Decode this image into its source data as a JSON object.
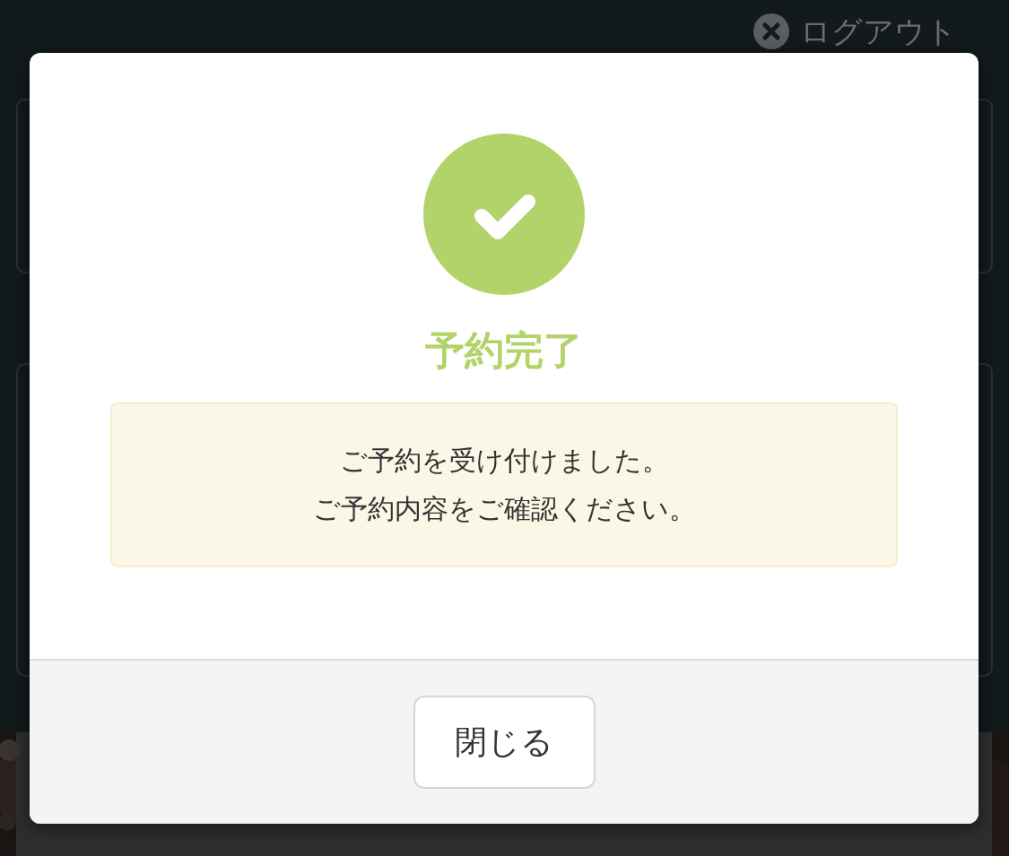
{
  "header": {
    "logout": "ログアウト"
  },
  "dialog": {
    "title": "予約完了",
    "message": [
      "ご予約を受け付けました。",
      "ご予約内容をご確認ください。"
    ],
    "close_button": "閉じる"
  }
}
